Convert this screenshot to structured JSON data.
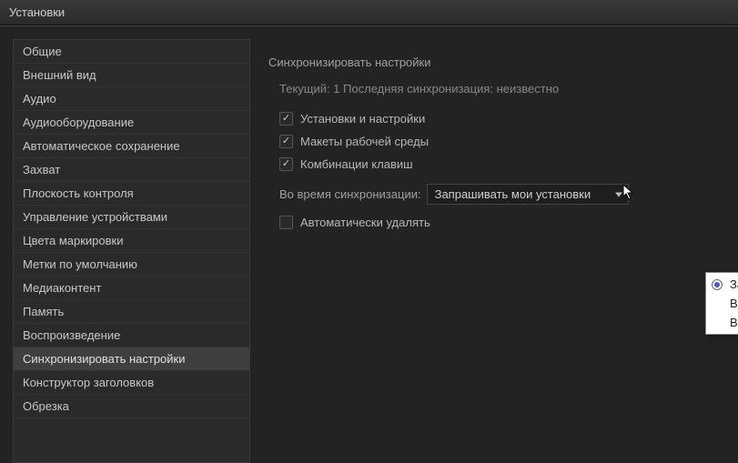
{
  "window": {
    "title": "Установки"
  },
  "sidebar": {
    "items": [
      {
        "label": "Общие"
      },
      {
        "label": "Внешний вид"
      },
      {
        "label": "Аудио"
      },
      {
        "label": "Аудиооборудование"
      },
      {
        "label": "Автоматическое сохранение"
      },
      {
        "label": "Захват"
      },
      {
        "label": "Плоскость контроля"
      },
      {
        "label": "Управление устройствами"
      },
      {
        "label": "Цвета маркировки"
      },
      {
        "label": "Метки по умолчанию"
      },
      {
        "label": "Медиаконтент"
      },
      {
        "label": "Память"
      },
      {
        "label": "Воспроизведение"
      },
      {
        "label": "Синхронизировать настройки"
      },
      {
        "label": "Конструктор заголовков"
      },
      {
        "label": "Обрезка"
      }
    ],
    "selectedIndex": 13
  },
  "main": {
    "sectionTitle": "Синхронизировать настройки",
    "statusLine": "Текущий: 1 Последняя синхронизация: неизвестно",
    "checks": [
      {
        "label": "Установки и настройки",
        "checked": true
      },
      {
        "label": "Макеты рабочей среды",
        "checked": true
      },
      {
        "label": "Комбинации клавиш",
        "checked": true
      }
    ],
    "dropdownLabel": "Во время синхронизации:",
    "dropdownValue": "Запрашивать мои установки",
    "autoDelete": {
      "label": "Автоматически удалять",
      "checked": false
    },
    "popup": {
      "options": [
        {
          "label": "Запрашивать мои установки",
          "selected": true
        },
        {
          "label": "Всегда передавать настройки",
          "selected": false
        },
        {
          "label": "Всегда загружать настройки",
          "selected": false
        }
      ]
    }
  }
}
